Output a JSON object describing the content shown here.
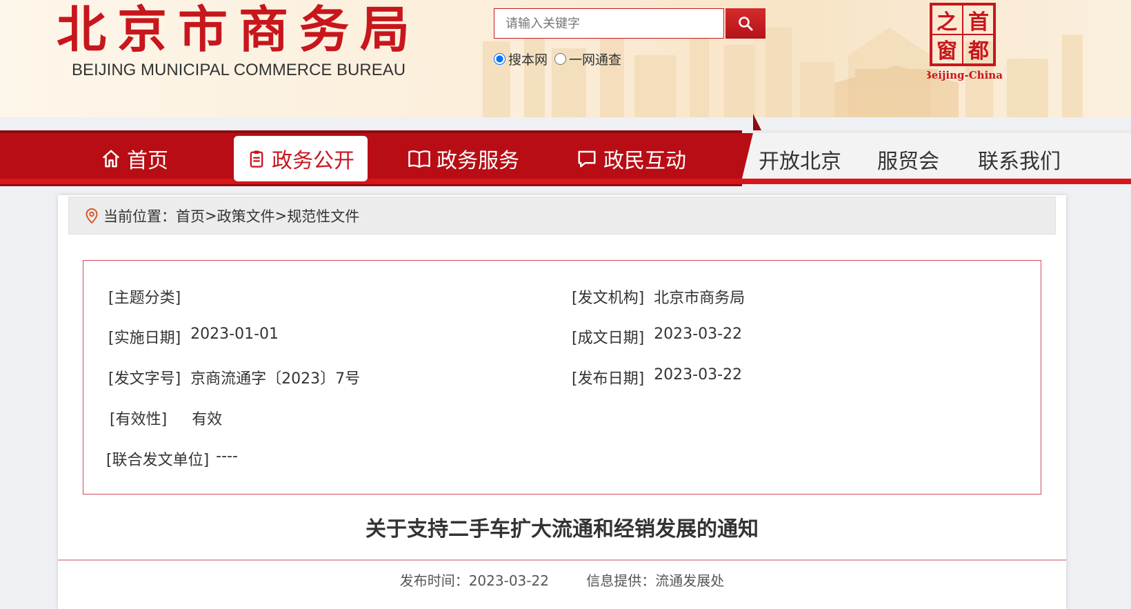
{
  "header": {
    "logo_cn": "北京市商务局",
    "logo_en": "BEIJING MUNICIPAL COMMERCE BUREAU",
    "search_placeholder": "请输入关键字",
    "radio_site": "搜本网",
    "radio_all": "一网通查",
    "capital_chars": [
      "之",
      "首",
      "窗",
      "都"
    ],
    "capital_en": "Beijing-China"
  },
  "nav": {
    "main": [
      {
        "label": "首页",
        "icon": "home-icon"
      },
      {
        "label": "政务公开",
        "icon": "clipboard-icon"
      },
      {
        "label": "政务服务",
        "icon": "book-icon"
      },
      {
        "label": "政民互动",
        "icon": "chat-icon"
      }
    ],
    "secondary": [
      "开放北京",
      "服贸会",
      "联系我们"
    ]
  },
  "breadcrumb": {
    "prefix": "当前位置：",
    "items": [
      "首页",
      "政策文件",
      "规范性文件"
    ],
    "sep": ">"
  },
  "meta": {
    "topic_label": "[主题分类]",
    "topic_value": "",
    "org_label": "[发文机构]",
    "org_value": "北京市商务局",
    "impl_label": "[实施日期]",
    "impl_value": "2023-01-01",
    "made_label": "[成文日期]",
    "made_value": "2023-03-22",
    "docno_label": "[发文字号]",
    "docno_value": "京商流通字〔2023〕7号",
    "pub_label": "[发布日期]",
    "pub_value": "2023-03-22",
    "valid_label": "[有效性]",
    "valid_value": "有效",
    "joint_label": "[联合发文单位]",
    "joint_value": "----"
  },
  "document": {
    "title": "关于支持二手车扩大流通和经销发展的通知",
    "publish_time": "发布时间：2023-03-22",
    "source": "信息提供：流通发展处"
  },
  "colors": {
    "brand_red": "#c8161d",
    "nav_dark_red": "#a80f14",
    "border_pink": "#d2475e"
  }
}
